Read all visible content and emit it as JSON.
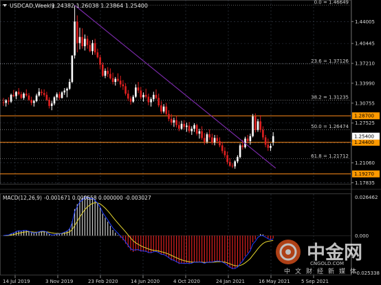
{
  "window": {
    "symbol_label": "USDCAD,Weekly",
    "ohlc": "1.24382 1.26038 1.23864 1.25400"
  },
  "colors": {
    "background": "#000000",
    "grid": "#39424f",
    "candle_up": "#ffffff",
    "candle_down": "#e02020",
    "fib_line": "#bfbfbf",
    "level_line": "#ff8c1a",
    "trendline": "#7a2aa8",
    "macd_hist": "#cfcfcf",
    "macd_signal": "#e8d830",
    "macd_line": "#1e3cff",
    "axis_text": "#d8d8d8",
    "price_tag_bg": "#ff9a00"
  },
  "chart_data": {
    "type": "candlestick",
    "title": "USDCAD,Weekly",
    "price_axis": {
      "ylim": [
        1.1755,
        1.475
      ],
      "tick_labels": [
        "1.44005",
        "1.40445",
        "1.37210",
        "1.33990",
        "1.30755",
        "1.27525",
        "1.24300",
        "1.21060",
        "1.17835"
      ]
    },
    "time_axis": {
      "labels": [
        "14 Jul 2019",
        "3 Nov 2019",
        "23 Feb 2020",
        "14 Jun 2020",
        "4 Oct 2020",
        "24 Jan 2021",
        "16 May 2021",
        "5 Sep 2021"
      ]
    },
    "fib_levels": [
      {
        "label": "0.0 = 1.46649",
        "value": 1.46649
      },
      {
        "label": "23.6 = 1.37126",
        "value": 1.37126
      },
      {
        "label": "38.2 = 1.31235",
        "value": 1.31235
      },
      {
        "label": "50.0 = 1.26474",
        "value": 1.26474
      },
      {
        "label": "61.8 = 1.21712",
        "value": 1.21712
      }
    ],
    "horizontal_levels": [
      {
        "value": 1.287,
        "tag": "1.28700"
      },
      {
        "value": 1.244,
        "tag": "1.24400"
      },
      {
        "value": 1.1927,
        "tag": "1.19270"
      }
    ],
    "current_price": {
      "value": 1.254,
      "tag": "1.25400"
    },
    "trendline": {
      "start": {
        "week": 28,
        "price": 1.4665
      },
      "end": {
        "week": 107,
        "price": 1.202
      }
    },
    "ohlc_weekly": [
      [
        1.309,
        1.316,
        1.303,
        1.308
      ],
      [
        1.308,
        1.314,
        1.302,
        1.312
      ],
      [
        1.312,
        1.317,
        1.305,
        1.31
      ],
      [
        1.31,
        1.323,
        1.308,
        1.321
      ],
      [
        1.321,
        1.329,
        1.317,
        1.319
      ],
      [
        1.319,
        1.327,
        1.314,
        1.326
      ],
      [
        1.326,
        1.332,
        1.32,
        1.322
      ],
      [
        1.322,
        1.326,
        1.314,
        1.316
      ],
      [
        1.316,
        1.325,
        1.313,
        1.323
      ],
      [
        1.323,
        1.33,
        1.318,
        1.32
      ],
      [
        1.32,
        1.324,
        1.311,
        1.313
      ],
      [
        1.313,
        1.318,
        1.304,
        1.308
      ],
      [
        1.308,
        1.313,
        1.302,
        1.311
      ],
      [
        1.311,
        1.323,
        1.309,
        1.32
      ],
      [
        1.32,
        1.332,
        1.318,
        1.326
      ],
      [
        1.326,
        1.33,
        1.32,
        1.324
      ],
      [
        1.324,
        1.33,
        1.318,
        1.321
      ],
      [
        1.321,
        1.326,
        1.311,
        1.313
      ],
      [
        1.313,
        1.317,
        1.299,
        1.303
      ],
      [
        1.303,
        1.311,
        1.296,
        1.307
      ],
      [
        1.307,
        1.319,
        1.304,
        1.317
      ],
      [
        1.317,
        1.325,
        1.312,
        1.322
      ],
      [
        1.322,
        1.326,
        1.313,
        1.316
      ],
      [
        1.316,
        1.327,
        1.315,
        1.325
      ],
      [
        1.325,
        1.332,
        1.321,
        1.328
      ],
      [
        1.328,
        1.333,
        1.317,
        1.331
      ],
      [
        1.331,
        1.347,
        1.329,
        1.342
      ],
      [
        1.342,
        1.37,
        1.34,
        1.385
      ],
      [
        1.385,
        1.4665,
        1.38,
        1.44
      ],
      [
        1.44,
        1.45,
        1.39,
        1.405
      ],
      [
        1.405,
        1.43,
        1.395,
        1.415
      ],
      [
        1.415,
        1.429,
        1.396,
        1.4
      ],
      [
        1.4,
        1.419,
        1.393,
        1.412
      ],
      [
        1.412,
        1.417,
        1.396,
        1.402
      ],
      [
        1.402,
        1.409,
        1.39,
        1.392
      ],
      [
        1.392,
        1.41,
        1.386,
        1.405
      ],
      [
        1.405,
        1.412,
        1.386,
        1.39
      ],
      [
        1.39,
        1.396,
        1.38,
        1.382
      ],
      [
        1.382,
        1.386,
        1.363,
        1.37
      ],
      [
        1.37,
        1.374,
        1.35,
        1.352
      ],
      [
        1.352,
        1.364,
        1.348,
        1.36
      ],
      [
        1.36,
        1.366,
        1.35,
        1.355
      ],
      [
        1.355,
        1.364,
        1.346,
        1.348
      ],
      [
        1.348,
        1.357,
        1.338,
        1.342
      ],
      [
        1.342,
        1.35,
        1.336,
        1.347
      ],
      [
        1.347,
        1.356,
        1.342,
        1.344
      ],
      [
        1.344,
        1.352,
        1.333,
        1.338
      ],
      [
        1.338,
        1.345,
        1.329,
        1.335
      ],
      [
        1.335,
        1.34,
        1.32,
        1.323
      ],
      [
        1.323,
        1.329,
        1.311,
        1.315
      ],
      [
        1.315,
        1.319,
        1.305,
        1.31
      ],
      [
        1.31,
        1.321,
        1.308,
        1.318
      ],
      [
        1.318,
        1.338,
        1.316,
        1.333
      ],
      [
        1.333,
        1.342,
        1.324,
        1.328
      ],
      [
        1.328,
        1.334,
        1.314,
        1.317
      ],
      [
        1.317,
        1.325,
        1.31,
        1.321
      ],
      [
        1.321,
        1.331,
        1.315,
        1.318
      ],
      [
        1.318,
        1.323,
        1.304,
        1.309
      ],
      [
        1.309,
        1.317,
        1.302,
        1.314
      ],
      [
        1.314,
        1.326,
        1.31,
        1.321
      ],
      [
        1.321,
        1.33,
        1.314,
        1.316
      ],
      [
        1.316,
        1.323,
        1.301,
        1.304
      ],
      [
        1.304,
        1.311,
        1.29,
        1.294
      ],
      [
        1.294,
        1.306,
        1.291,
        1.302
      ],
      [
        1.302,
        1.308,
        1.288,
        1.29
      ],
      [
        1.29,
        1.296,
        1.278,
        1.282
      ],
      [
        1.282,
        1.29,
        1.272,
        1.276
      ],
      [
        1.276,
        1.284,
        1.269,
        1.28
      ],
      [
        1.28,
        1.287,
        1.268,
        1.272
      ],
      [
        1.272,
        1.278,
        1.262,
        1.266
      ],
      [
        1.266,
        1.279,
        1.264,
        1.274
      ],
      [
        1.274,
        1.28,
        1.265,
        1.269
      ],
      [
        1.269,
        1.276,
        1.261,
        1.271
      ],
      [
        1.271,
        1.277,
        1.259,
        1.262
      ],
      [
        1.262,
        1.27,
        1.256,
        1.266
      ],
      [
        1.266,
        1.275,
        1.261,
        1.272
      ],
      [
        1.272,
        1.274,
        1.255,
        1.258
      ],
      [
        1.258,
        1.266,
        1.25,
        1.262
      ],
      [
        1.262,
        1.27,
        1.248,
        1.251
      ],
      [
        1.251,
        1.259,
        1.24,
        1.245
      ],
      [
        1.245,
        1.26,
        1.242,
        1.257
      ],
      [
        1.257,
        1.265,
        1.248,
        1.252
      ],
      [
        1.252,
        1.258,
        1.24,
        1.244
      ],
      [
        1.244,
        1.256,
        1.239,
        1.251
      ],
      [
        1.251,
        1.256,
        1.242,
        1.246
      ],
      [
        1.246,
        1.252,
        1.236,
        1.239
      ],
      [
        1.239,
        1.245,
        1.226,
        1.23
      ],
      [
        1.23,
        1.236,
        1.219,
        1.223
      ],
      [
        1.223,
        1.229,
        1.208,
        1.212
      ],
      [
        1.212,
        1.218,
        1.204,
        1.206
      ],
      [
        1.206,
        1.21,
        1.202,
        1.205
      ],
      [
        1.205,
        1.215,
        1.201,
        1.213
      ],
      [
        1.213,
        1.223,
        1.21,
        1.22
      ],
      [
        1.22,
        1.242,
        1.218,
        1.239
      ],
      [
        1.239,
        1.248,
        1.232,
        1.236
      ],
      [
        1.236,
        1.253,
        1.234,
        1.25
      ],
      [
        1.25,
        1.256,
        1.242,
        1.246
      ],
      [
        1.246,
        1.258,
        1.24,
        1.254
      ],
      [
        1.254,
        1.29,
        1.252,
        1.286
      ],
      [
        1.286,
        1.291,
        1.26,
        1.264
      ],
      [
        1.264,
        1.282,
        1.261,
        1.278
      ],
      [
        1.278,
        1.288,
        1.26,
        1.264
      ],
      [
        1.264,
        1.27,
        1.248,
        1.252
      ],
      [
        1.252,
        1.256,
        1.236,
        1.24
      ],
      [
        1.24,
        1.25,
        1.23,
        1.235
      ],
      [
        1.235,
        1.242,
        1.23,
        1.238
      ],
      [
        1.2438,
        1.2604,
        1.2386,
        1.254
      ]
    ],
    "macd": {
      "label": "MACD(12,26,9)",
      "values_text": "-0.001671 0.000658 0.000000 -0.003027",
      "ylim": [
        -0.025338,
        0.026462
      ],
      "tick_labels": [
        "0.026462",
        "0.000",
        "-0.025338"
      ]
    }
  }
}
